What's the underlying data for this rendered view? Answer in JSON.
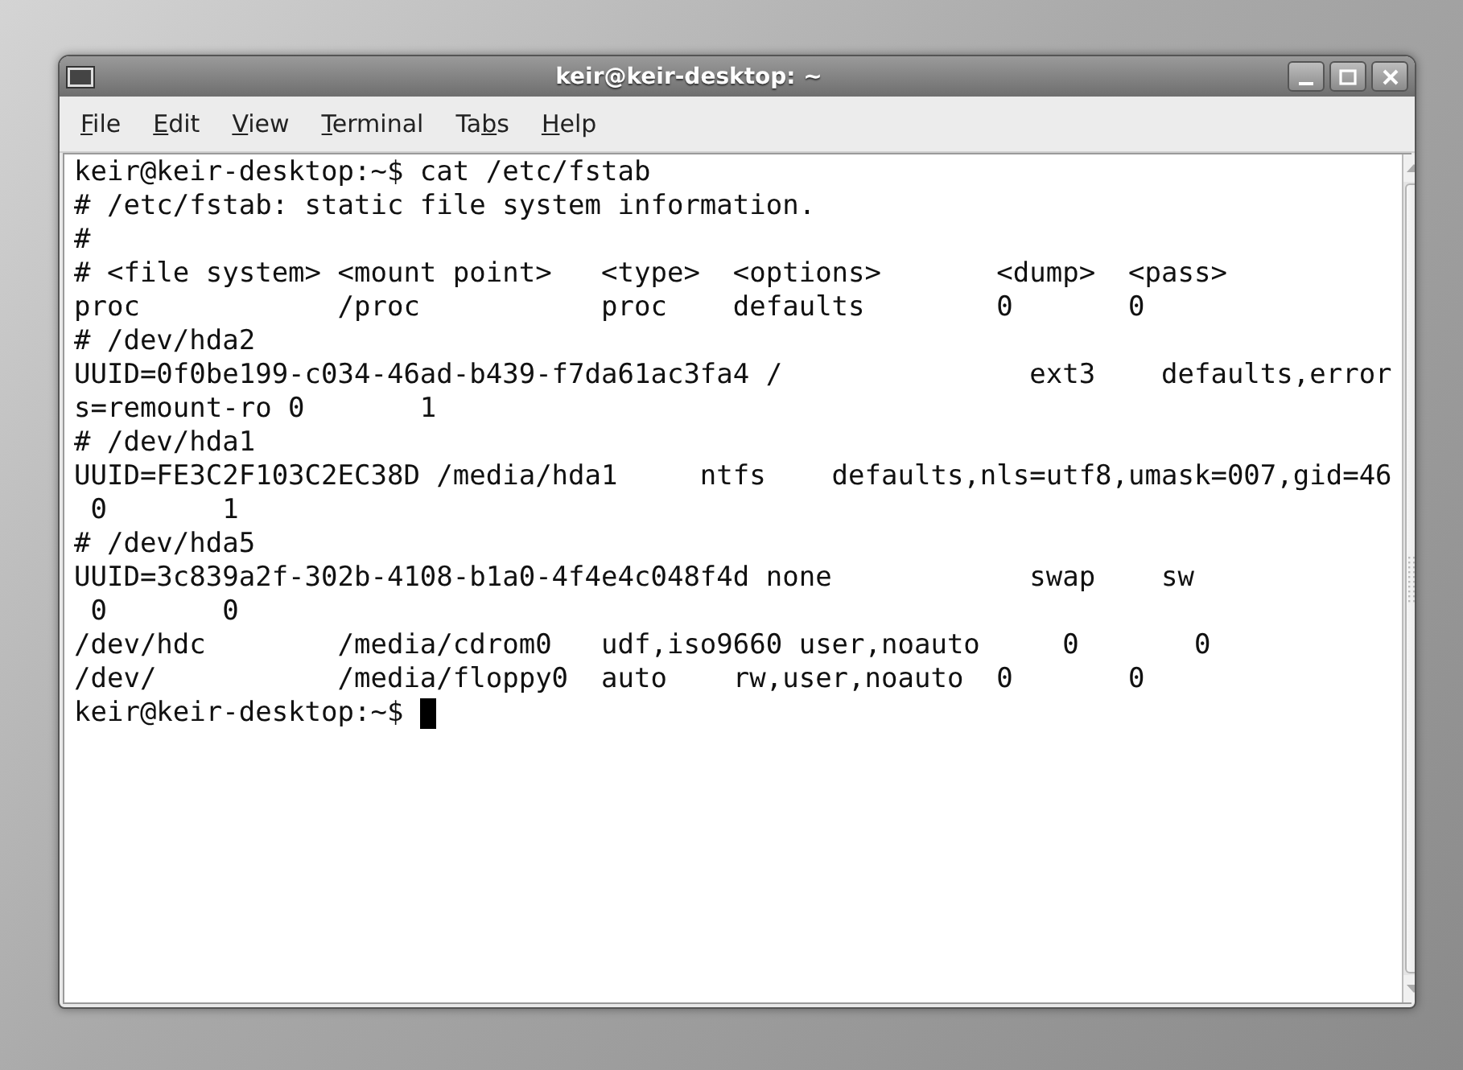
{
  "window": {
    "title": "keir@keir-desktop: ~"
  },
  "menu": [
    {
      "key": "F",
      "after": "ile"
    },
    {
      "key": "E",
      "after": "dit"
    },
    {
      "key": "V",
      "after": "iew"
    },
    {
      "key": "T",
      "after": "erminal"
    },
    {
      "before": "Ta",
      "key": "b",
      "after": "s"
    },
    {
      "key": "H",
      "after": "elp"
    }
  ],
  "terminal": {
    "lines": [
      "keir@keir-desktop:~$ cat /etc/fstab",
      "# /etc/fstab: static file system information.",
      "#",
      "# <file system> <mount point>   <type>  <options>       <dump>  <pass>",
      "proc            /proc           proc    defaults        0       0",
      "# /dev/hda2",
      "UUID=0f0be199-c034-46ad-b439-f7da61ac3fa4 /               ext3    defaults,error",
      "s=remount-ro 0       1",
      "# /dev/hda1",
      "UUID=FE3C2F103C2EC38D /media/hda1     ntfs    defaults,nls=utf8,umask=007,gid=46",
      " 0       1",
      "# /dev/hda5",
      "UUID=3c839a2f-302b-4108-b1a0-4f4e4c048f4d none            swap    sw",
      " 0       0",
      "/dev/hdc        /media/cdrom0   udf,iso9660 user,noauto     0       0",
      "/dev/           /media/floppy0  auto    rw,user,noauto  0       0"
    ],
    "prompt": "keir@keir-desktop:~$ ",
    "cursor_visible": true
  }
}
